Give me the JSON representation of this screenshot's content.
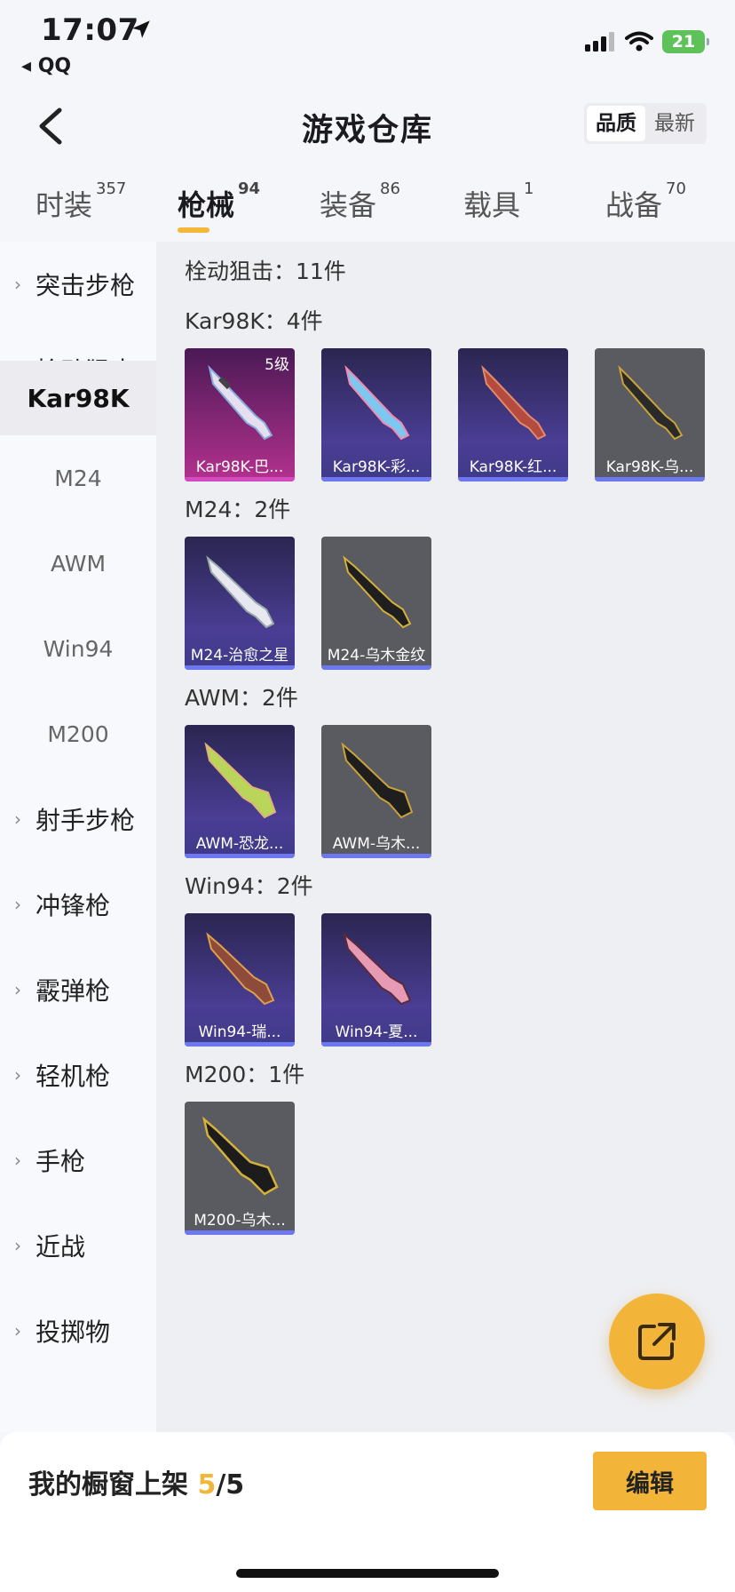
{
  "status_bar": {
    "time": "17:07",
    "back_app": "QQ",
    "battery": "21",
    "colors": {
      "battery": "#5fc15a"
    }
  },
  "header": {
    "title": "游戏仓库",
    "sort_options": [
      "品质",
      "最新"
    ],
    "active_sort": "品质"
  },
  "tabs": [
    {
      "label": "时装",
      "count": "357"
    },
    {
      "label": "枪械",
      "count": "94",
      "active": true
    },
    {
      "label": "装备",
      "count": "86"
    },
    {
      "label": "载具",
      "count": "1"
    },
    {
      "label": "战备",
      "count": "70"
    }
  ],
  "sidebar": {
    "items": [
      {
        "label": "突击步枪",
        "expandable": true
      },
      {
        "label": "栓动狙击",
        "expandable": true,
        "expanded": true
      },
      {
        "label": "Kar98K",
        "sub": true,
        "selected": true
      },
      {
        "label": "M24",
        "sub": true
      },
      {
        "label": "AWM",
        "sub": true
      },
      {
        "label": "Win94",
        "sub": true
      },
      {
        "label": "M200",
        "sub": true
      },
      {
        "label": "射手步枪",
        "expandable": true
      },
      {
        "label": "冲锋枪",
        "expandable": true
      },
      {
        "label": "霰弹枪",
        "expandable": true
      },
      {
        "label": "轻机枪",
        "expandable": true
      },
      {
        "label": "手枪",
        "expandable": true
      },
      {
        "label": "近战",
        "expandable": true
      },
      {
        "label": "投掷物",
        "expandable": true
      }
    ]
  },
  "content": {
    "category_summary": "栓动狙击：11件",
    "groups": [
      {
        "title": "Kar98K：4件",
        "items": [
          {
            "name": "Kar98K-巴...",
            "rarity": "pink",
            "level": "5级"
          },
          {
            "name": "Kar98K-彩...",
            "rarity": "purple"
          },
          {
            "name": "Kar98K-红...",
            "rarity": "purple"
          },
          {
            "name": "Kar98K-乌...",
            "rarity": "gray"
          }
        ]
      },
      {
        "title": "M24：2件",
        "items": [
          {
            "name": "M24-治愈之星",
            "rarity": "purple"
          },
          {
            "name": "M24-乌木金纹",
            "rarity": "gray"
          }
        ]
      },
      {
        "title": "AWM：2件",
        "items": [
          {
            "name": "AWM-恐龙...",
            "rarity": "purple"
          },
          {
            "name": "AWM-乌木...",
            "rarity": "gray"
          }
        ]
      },
      {
        "title": "Win94：2件",
        "items": [
          {
            "name": "Win94-瑞...",
            "rarity": "purple"
          },
          {
            "name": "Win94-夏...",
            "rarity": "purple"
          }
        ]
      },
      {
        "title": "M200：1件",
        "items": [
          {
            "name": "M200-乌木...",
            "rarity": "gray"
          }
        ]
      }
    ]
  },
  "fab": {
    "icon": "share-icon"
  },
  "bottom_bar": {
    "label": "我的橱窗上架",
    "count_current": "5",
    "count_total": "/5",
    "edit_label": "编辑"
  }
}
